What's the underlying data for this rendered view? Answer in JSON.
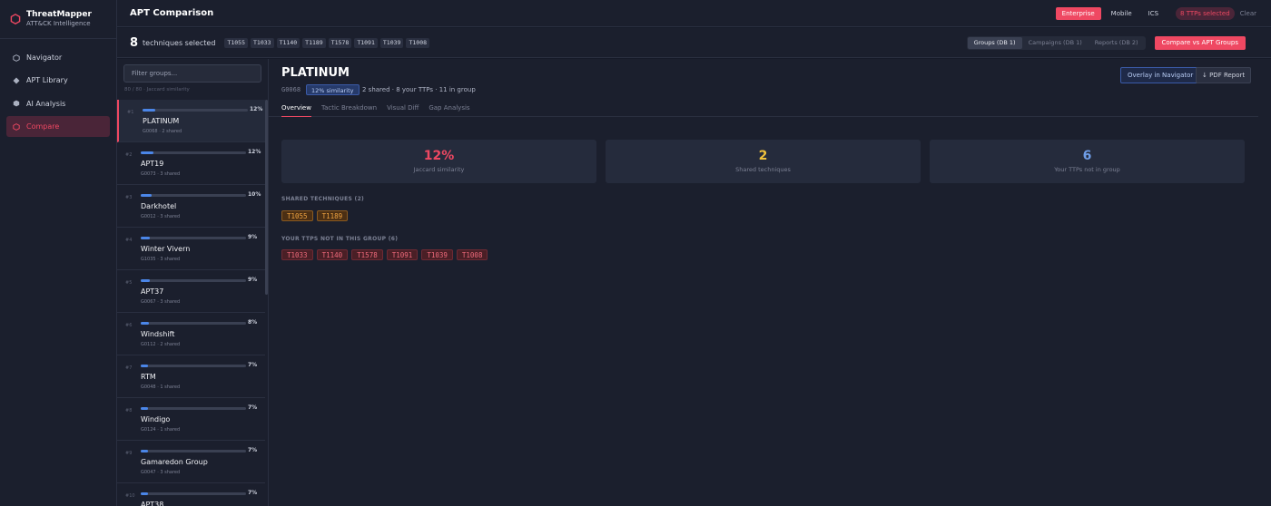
{
  "app": {
    "name": "ThreatMapper",
    "subtitle": "ATT&CK Intelligence"
  },
  "sidebar": {
    "items": [
      {
        "label": "Navigator",
        "icon": "hexagon-outline-icon",
        "active": false
      },
      {
        "label": "APT Library",
        "icon": "diamond-icon",
        "active": false
      },
      {
        "label": "AI Analysis",
        "icon": "hexagon-filled-icon",
        "active": false
      },
      {
        "label": "Compare",
        "icon": "hexagon-outline-icon",
        "active": true
      }
    ]
  },
  "header": {
    "title": "APT Comparison",
    "domains": [
      "Enterprise",
      "Mobile",
      "ICS"
    ],
    "active_domain": "Enterprise",
    "ttps_selected": "8 TTPs selected",
    "clear": "Clear"
  },
  "selection": {
    "count": "8",
    "label": "techniques selected",
    "techniques": [
      "T1055",
      "T1033",
      "T1140",
      "T1189",
      "T1578",
      "T1091",
      "T1039",
      "T1008"
    ],
    "sources": [
      "Groups (DB 1)",
      "Campaigns (DB 1)",
      "Reports (DB 2)"
    ],
    "compare_button": "Compare vs APT Groups"
  },
  "groups_panel": {
    "filter_placeholder": "Filter groups...",
    "hint": "80 / 80 · Jaccard similarity",
    "groups": [
      {
        "rank": "#1",
        "name": "PLATINUM",
        "meta": "G0068 · 2 shared",
        "pct_label": "12%",
        "pct": 12
      },
      {
        "rank": "#2",
        "name": "APT19",
        "meta": "G0073 · 3 shared",
        "pct_label": "12%",
        "pct": 12
      },
      {
        "rank": "#3",
        "name": "Darkhotel",
        "meta": "G0012 · 3 shared",
        "pct_label": "10%",
        "pct": 10
      },
      {
        "rank": "#4",
        "name": "Winter Vivern",
        "meta": "G1035 · 3 shared",
        "pct_label": "9%",
        "pct": 9
      },
      {
        "rank": "#5",
        "name": "APT37",
        "meta": "G0067 · 3 shared",
        "pct_label": "9%",
        "pct": 9
      },
      {
        "rank": "#6",
        "name": "Windshift",
        "meta": "G0112 · 2 shared",
        "pct_label": "8%",
        "pct": 8
      },
      {
        "rank": "#7",
        "name": "RTM",
        "meta": "G0048 · 1 shared",
        "pct_label": "7%",
        "pct": 7
      },
      {
        "rank": "#8",
        "name": "Windigo",
        "meta": "G0124 · 1 shared",
        "pct_label": "7%",
        "pct": 7
      },
      {
        "rank": "#9",
        "name": "Gamaredon Group",
        "meta": "G0047 · 3 shared",
        "pct_label": "7%",
        "pct": 7
      },
      {
        "rank": "#10",
        "name": "APT38",
        "meta": "",
        "pct_label": "7%",
        "pct": 7
      }
    ]
  },
  "detail": {
    "name": "PLATINUM",
    "id": "G0068",
    "similarity_badge": "12% similarity",
    "meta": "2 shared · 8 your TTPs · 11 in group",
    "overlay_button": "Overlay in Navigator",
    "pdf_button": "↓ PDF Report",
    "tabs": [
      "Overview",
      "Tactic Breakdown",
      "Visual Diff",
      "Gap Analysis"
    ],
    "active_tab": "Overview",
    "stats": [
      {
        "value": "12%",
        "label": "Jaccard similarity",
        "color": "#ef4862"
      },
      {
        "value": "2",
        "label": "Shared techniques",
        "color": "#f0c23c"
      },
      {
        "value": "6",
        "label": "Your TTPs not in group",
        "color": "#6f9ee8"
      }
    ],
    "shared_title": "SHARED TECHNIQUES (2)",
    "shared": [
      "T1055",
      "T1189"
    ],
    "missing_title": "YOUR TTPS NOT IN THIS GROUP (6)",
    "missing": [
      "T1033",
      "T1140",
      "T1578",
      "T1091",
      "T1039",
      "T1008"
    ]
  }
}
